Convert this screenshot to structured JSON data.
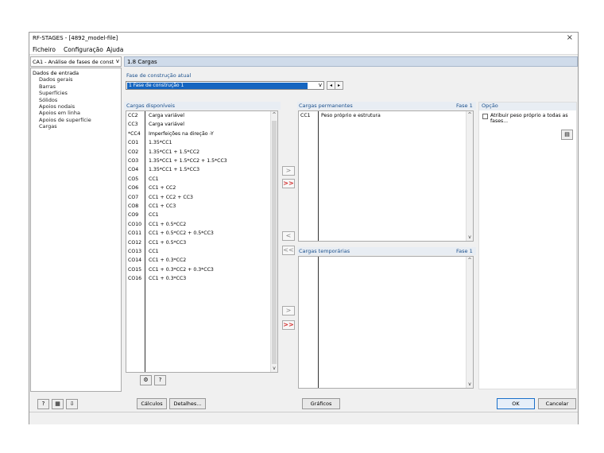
{
  "window": {
    "title": "RF-STAGES - [4892_model-file]",
    "close": "×"
  },
  "menu": [
    "Ficheiro",
    "Configuração",
    "Ajuda"
  ],
  "case_combo": "CA1 - Análise de fases de const",
  "nav": {
    "root": "Dados de entrada",
    "items": [
      "Dados gerais",
      "Barras",
      "Superfícies",
      "Sólidos",
      "Apoios nodais",
      "Apoios em linha",
      "Apoios de superfície",
      "Cargas"
    ]
  },
  "panel_title": "1.8 Cargas",
  "stage": {
    "label": "Fase de construção atual",
    "value": "1  Fase de construção 1"
  },
  "available": {
    "label": "Cargas disponíveis",
    "rows": [
      [
        "CC2",
        "Carga variável"
      ],
      [
        "CC3",
        "Carga variável"
      ],
      [
        "*CC4",
        "Imperfeições na direção -Y"
      ],
      [
        "CO1",
        "1.35*CC1"
      ],
      [
        "CO2",
        "1.35*CC1 + 1.5*CC2"
      ],
      [
        "CO3",
        "1.35*CC1 + 1.5*CC2 + 1.5*CC3"
      ],
      [
        "CO4",
        "1.35*CC1 + 1.5*CC3"
      ],
      [
        "CO5",
        "CC1"
      ],
      [
        "CO6",
        "CC1 + CC2"
      ],
      [
        "CO7",
        "CC1 + CC2 + CC3"
      ],
      [
        "CO8",
        "CC1 + CC3"
      ],
      [
        "CO9",
        "CC1"
      ],
      [
        "CO10",
        "CC1 + 0.5*CC2"
      ],
      [
        "CO11",
        "CC1 + 0.5*CC2 + 0.5*CC3"
      ],
      [
        "CO12",
        "CC1 + 0.5*CC3"
      ],
      [
        "CO13",
        "CC1"
      ],
      [
        "CO14",
        "CC1 + 0.3*CC2"
      ],
      [
        "CO15",
        "CC1 + 0.3*CC2 + 0.3*CC3"
      ],
      [
        "CO16",
        "CC1 + 0.3*CC3"
      ]
    ]
  },
  "permanent": {
    "label": "Cargas permanentes",
    "phase": "Fase 1",
    "rows": [
      [
        "CC1",
        "Peso próprio e estrutura"
      ]
    ]
  },
  "temporary": {
    "label": "Cargas temporárias",
    "phase": "Fase 1"
  },
  "option": {
    "label": "Opção",
    "checkbox": "Atribuir peso próprio a todas as fases..."
  },
  "buttons": {
    "calc": "Cálculos",
    "details": "Detalhes...",
    "graphics": "Gráficos",
    "ok": "OK",
    "cancel": "Cancelar"
  },
  "arrows": {
    "move_one": ">",
    "move_all": ">>",
    "remove_one": "<",
    "remove_all": "<<",
    "up": "^",
    "down": "v",
    "dropdown": "v",
    "prev": "◂",
    "next": "▸"
  }
}
